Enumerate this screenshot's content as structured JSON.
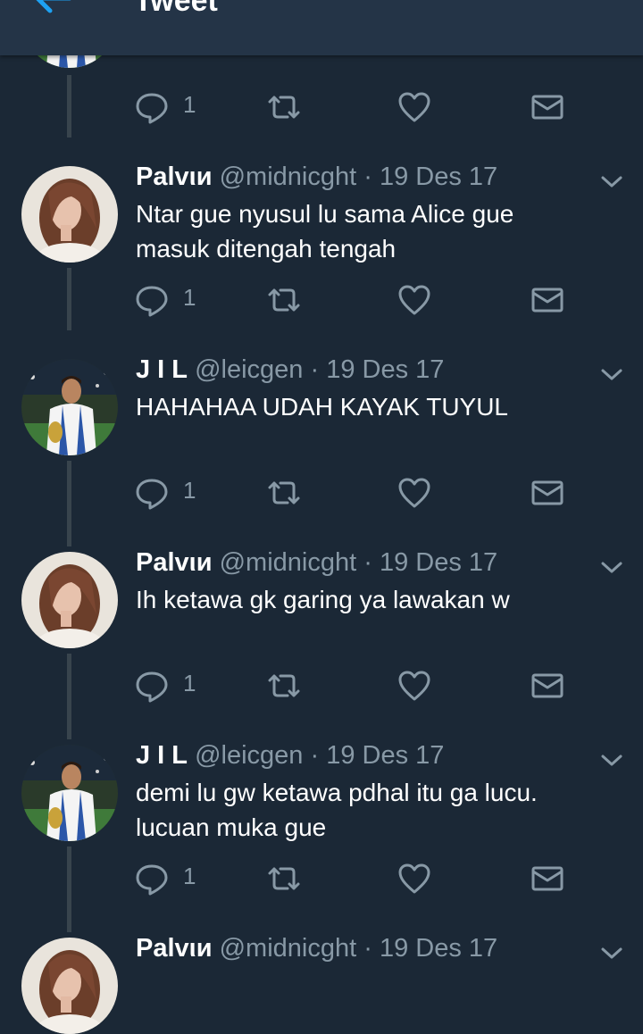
{
  "header": {
    "title": "Tweet",
    "back_icon": "arrow-left-icon"
  },
  "colors": {
    "background": "#1b2836",
    "header": "#243447",
    "accent": "#1da1f2",
    "muted": "#8899a6"
  },
  "tweets": [
    {
      "name": "Palvιи",
      "handle": "@midnicght",
      "dot": "·",
      "date": "19 Des 17",
      "lines": [
        "Ntar gue nyusul lu sama Alice gue",
        "masuk ditengah tengah"
      ],
      "reply_count": "1"
    },
    {
      "name": "J I L",
      "handle": "@leicgen",
      "dot": "·",
      "date": "19 Des 17",
      "lines": [
        "HAHAHAA UDAH KAYAK TUYUL"
      ],
      "reply_count": "1"
    },
    {
      "name": "Palvιи",
      "handle": "@midnicght",
      "dot": "·",
      "date": "19 Des 17",
      "lines": [
        "Ih ketawa gk garing ya lawakan w"
      ],
      "reply_count": "1"
    },
    {
      "name": "J I L",
      "handle": "@leicgen",
      "dot": "·",
      "date": "19 Des 17",
      "lines": [
        "demi lu gw ketawa pdhal itu ga lucu.",
        "lucuan muka gue"
      ],
      "reply_count": "1"
    },
    {
      "name": "Palvιи",
      "handle": "@midnicght",
      "dot": "·",
      "date": "19 Des 17",
      "lines": [],
      "reply_count": ""
    }
  ],
  "top_actions": {
    "reply_count": "1"
  }
}
